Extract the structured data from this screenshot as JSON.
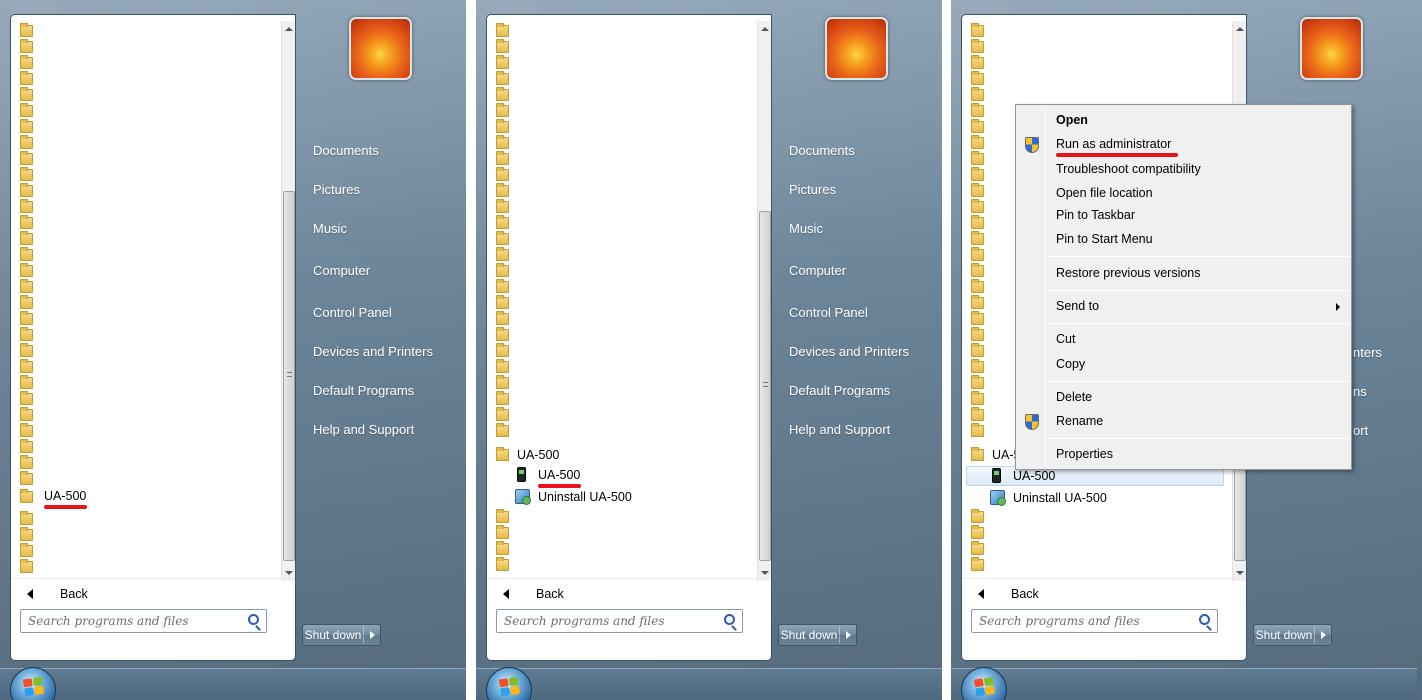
{
  "panels": [
    {
      "id": "panel-1",
      "programs": {
        "item_label": "UA-500"
      },
      "right_menu": [
        "Documents",
        "Pictures",
        "Music",
        "Computer",
        "Control Panel",
        "Devices and Printers",
        "Default Programs",
        "Help and Support"
      ],
      "back_label": "Back",
      "search_placeholder": "Search programs and files",
      "shutdown_label": "Shut down"
    },
    {
      "id": "panel-2",
      "programs": {
        "folder_label": "UA-500",
        "app_label": "UA-500",
        "uninstall_label": "Uninstall UA-500"
      },
      "right_menu": [
        "Documents",
        "Pictures",
        "Music",
        "Computer",
        "Control Panel",
        "Devices and Printers",
        "Default Programs",
        "Help and Support"
      ],
      "back_label": "Back",
      "search_placeholder": "Search programs and files",
      "shutdown_label": "Shut down"
    },
    {
      "id": "panel-3",
      "programs": {
        "folder_label": "UA-5",
        "app_label": "UA-500",
        "uninstall_label": "Uninstall UA-500"
      },
      "right_menu_partial": [
        "nters",
        "ns",
        "ort"
      ],
      "back_label": "Back",
      "search_placeholder": "Search programs and files",
      "shutdown_label": "Shut down"
    }
  ],
  "context_menu": {
    "open": "Open",
    "run_as_admin": "Run as administrator",
    "troubleshoot": "Troubleshoot compatibility",
    "open_file_location": "Open file location",
    "pin_taskbar": "Pin to Taskbar",
    "pin_start": "Pin to Start Menu",
    "restore": "Restore previous versions",
    "send_to": "Send to",
    "cut": "Cut",
    "copy": "Copy",
    "delete": "Delete",
    "rename": "Rename",
    "properties": "Properties"
  },
  "colors": {
    "highlight_underline": "#e8121a",
    "menu_background": "#6a8397",
    "context_menu_background": "#f0f0f0"
  }
}
